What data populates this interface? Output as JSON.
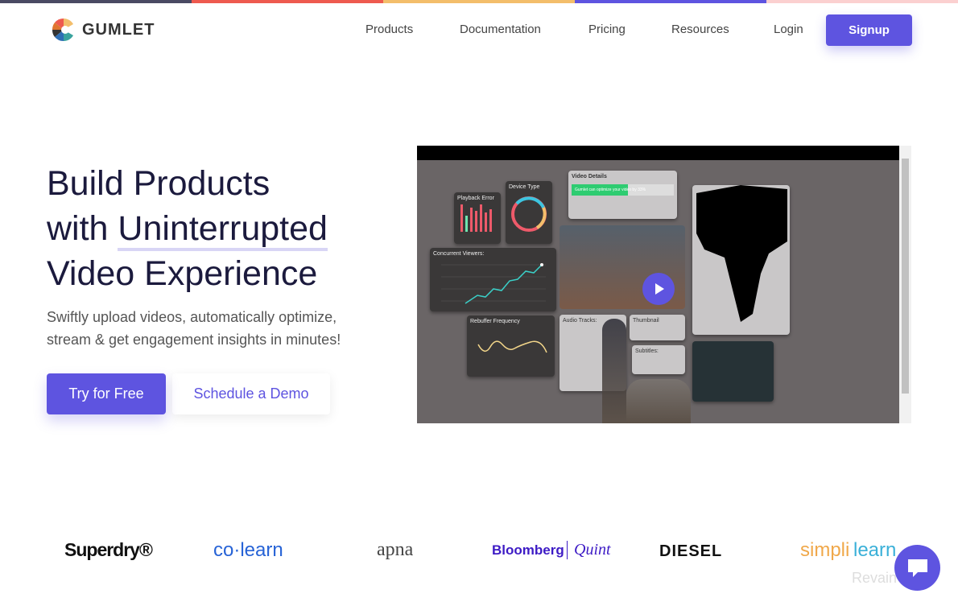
{
  "top_stripe_colors": [
    "#4a4a63",
    "#ee5a4f",
    "#f3be6b",
    "#5e54e0",
    "#fbd0d0"
  ],
  "brand": {
    "name": "GUMLET",
    "accent": "#5e54e0"
  },
  "nav": {
    "items": [
      "Products",
      "Documentation",
      "Pricing",
      "Resources",
      "Login"
    ],
    "signup": "Signup"
  },
  "hero": {
    "title_line1": "Build Products",
    "title_line2_pre": "with ",
    "title_line2_hl": "Uninterrupted",
    "title_line3": "Video Experience",
    "subtitle_line1": "Swiftly upload videos, automatically optimize,",
    "subtitle_line2": "stream & get engagement insights in minutes!",
    "cta_primary": "Try for Free",
    "cta_secondary": "Schedule a Demo"
  },
  "video": {
    "panels": {
      "playback_error": "Playback Error",
      "device_type": "Device Type",
      "video_details": "Video Details",
      "optimize_msg": "Gumlet can optimize your video by 33%",
      "concurrent_viewers": "Concurrent Viewers:",
      "rebuffer": "Rebuffer Frequency",
      "audio_tracks": "Audio Tracks:",
      "thumbnail": "Thumbnail",
      "subtitles": "Subtitles:"
    },
    "play_icon": "play-icon"
  },
  "logos": [
    "Superdry®",
    "co·learn",
    "apna",
    "Bloomberg",
    "Quint",
    "DIESEL",
    "simpli",
    "learn"
  ],
  "watermark": "Revain",
  "chat_icon": "chat-bubble-icon"
}
